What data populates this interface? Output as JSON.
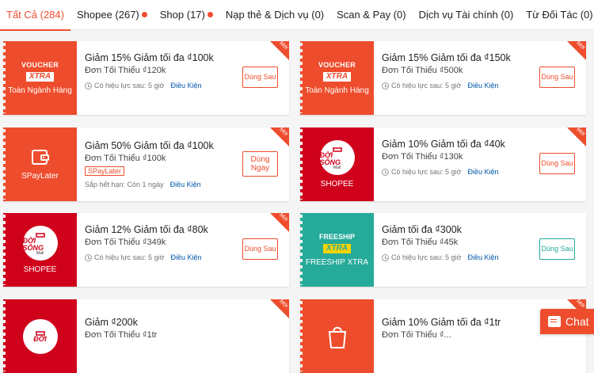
{
  "tabs": [
    {
      "label": "Tất Cả (284)",
      "dot": false,
      "active": true
    },
    {
      "label": "Shopee (267)",
      "dot": true
    },
    {
      "label": "Shop (17)",
      "dot": true
    },
    {
      "label": "Nạp thẻ & Dịch vụ (0)",
      "dot": false
    },
    {
      "label": "Scan & Pay (0)",
      "dot": false
    },
    {
      "label": "Dịch vụ Tài chính (0)",
      "dot": false
    },
    {
      "label": "Từ Đối Tác (0)",
      "dot": false
    }
  ],
  "ribbon_label": "Mới",
  "vouchers": [
    {
      "logo": "voucher-xtra",
      "logo_top": "VOUCHER",
      "logo_bottom": "XTRA",
      "caption": "Toàn Ngành Hàng",
      "title": "Giảm 15% Giảm tối đa ₫100k",
      "sub": "Đơn Tối Thiểu ₫120k",
      "meta": "Có hiệu lực sau: 5 giờ",
      "link": "Điều Kiện",
      "button": "Dùng Sau"
    },
    {
      "logo": "voucher-xtra",
      "logo_top": "VOUCHER",
      "logo_bottom": "XTRA",
      "caption": "Toàn Ngành Hàng",
      "title": "Giảm 15% Giảm tối đa ₫150k",
      "sub": "Đơn Tối Thiểu ₫500k",
      "meta": "Có hiệu lực sau: 5 giờ",
      "link": "Điều Kiện",
      "button": "Dùng Sau"
    },
    {
      "logo": "wallet-icon",
      "caption": "SPayLater",
      "title": "Giảm 50% Giảm tối đa ₫100k",
      "sub": "Đơn Tối Thiểu ₫100k",
      "tag": "SPayLater",
      "meta": "Sắp hết hạn: Còn 1 ngày",
      "link": "Điều Kiện",
      "button": "Dùng Ngay"
    },
    {
      "logo": "doi-song",
      "logo_top": "ĐỜI SỐNG",
      "logo_bottom": "Mall",
      "caption": "SHOPEE",
      "title": "Giảm 10% Giảm tối đa ₫40k",
      "sub": "Đơn Tối Thiểu ₫130k",
      "meta": "Có hiệu lực sau: 5 giờ",
      "link": "Điều Kiện",
      "button": "Dùng Sau"
    },
    {
      "logo": "doi-song",
      "logo_top": "ĐỜI SỐNG",
      "logo_bottom": "Mall",
      "caption": "SHOPEE",
      "title": "Giảm 12% Giảm tối đa ₫80k",
      "sub": "Đơn Tối Thiểu ₫349k",
      "meta": "Có hiệu lực sau: 5 giờ",
      "link": "Điều Kiện",
      "button": "Dùng Sau"
    },
    {
      "logo": "freeship-xtra",
      "logo_top": "FREESHIP",
      "logo_bottom": "XTRA",
      "caption": "FREESHIP XTRA",
      "title": "Giảm tối đa ₫300k",
      "sub": "Đơn Tối Thiểu ₫45k",
      "meta": "Có hiệu lực sau: 5 giờ",
      "link": "Điều Kiện",
      "button": "Dùng Sau"
    },
    {
      "logo": "doi-song",
      "logo_top": "ĐỜI",
      "caption": "",
      "title": "Giảm ₫200k",
      "sub": "Đơn Tối Thiểu ₫1tr",
      "meta": "",
      "link": "",
      "button": ""
    },
    {
      "logo": "shopee-bag",
      "caption": "",
      "title": "Giảm 10% Giảm tối đa ₫1tr",
      "sub": "Đơn Tối Thiểu ₫...",
      "meta": "",
      "link": "",
      "button": ""
    }
  ],
  "chat_label": "Chat",
  "colors": {
    "brand": "#ee4d2d",
    "mall_red": "#d0011b",
    "freeship_teal": "#26aa99",
    "link": "#0055aa"
  }
}
